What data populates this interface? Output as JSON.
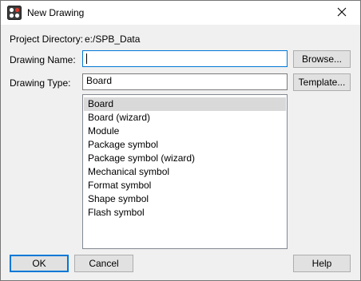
{
  "window": {
    "title": "New Drawing"
  },
  "form": {
    "project_directory_label": "Project Directory:",
    "project_directory_value": "e:/SPB_Data",
    "drawing_name_label": "Drawing Name:",
    "drawing_name_value": "",
    "drawing_type_label": "Drawing Type:",
    "drawing_type_value": "Board"
  },
  "buttons": {
    "browse": "Browse...",
    "template": "Template...",
    "ok": "OK",
    "cancel": "Cancel",
    "help": "Help"
  },
  "drawing_types": [
    {
      "label": "Board",
      "selected": true
    },
    {
      "label": "Board (wizard)",
      "selected": false
    },
    {
      "label": "Module",
      "selected": false
    },
    {
      "label": "Package symbol",
      "selected": false
    },
    {
      "label": "Package symbol (wizard)",
      "selected": false
    },
    {
      "label": "Mechanical symbol",
      "selected": false
    },
    {
      "label": "Format symbol",
      "selected": false
    },
    {
      "label": "Shape symbol",
      "selected": false
    },
    {
      "label": "Flash symbol",
      "selected": false
    }
  ],
  "icons": {
    "app": "app-logo-icon",
    "close": "close-icon"
  }
}
